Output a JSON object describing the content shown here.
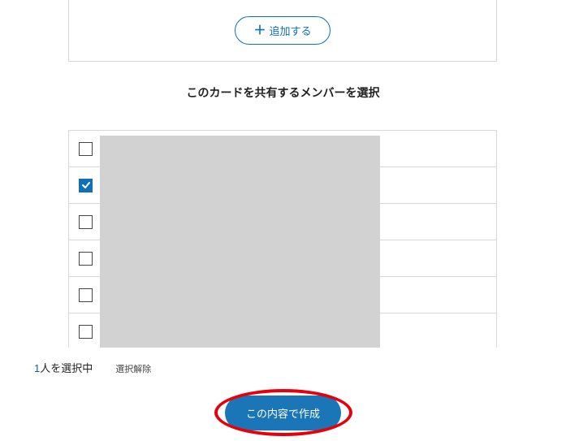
{
  "addButton": {
    "label": "追加する"
  },
  "sectionTitle": "このカードを共有するメンバーを選択",
  "members": [
    {
      "checked": false
    },
    {
      "checked": true
    },
    {
      "checked": false
    },
    {
      "checked": false
    },
    {
      "checked": false
    },
    {
      "checked": false
    }
  ],
  "status": {
    "count": "1",
    "countSuffix": "人を選択中",
    "clearLabel": "選択解除"
  },
  "submit": {
    "label": "この内容で作成"
  }
}
